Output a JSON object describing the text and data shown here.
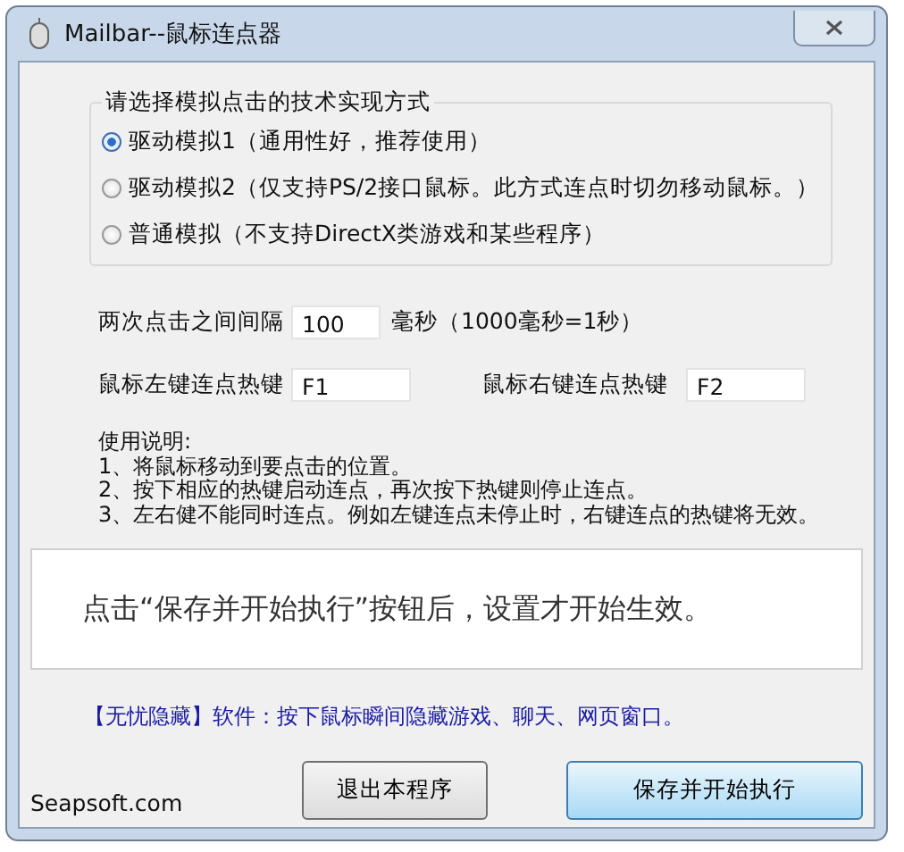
{
  "window": {
    "title": "Mailbar--鼠标连点器"
  },
  "mode_group": {
    "title": "请选择模拟点击的技术实现方式",
    "options": [
      {
        "label": "驱动模拟1（通用性好，推荐使用）",
        "selected": true
      },
      {
        "label": "驱动模拟2（仅支持PS/2接口鼠标。此方式连点时切勿移动鼠标。）",
        "selected": false
      },
      {
        "label": "普通模拟（不支持DirectX类游戏和某些程序）",
        "selected": false
      }
    ]
  },
  "interval": {
    "label": "两次点击之间间隔",
    "value": "100",
    "unit": "毫秒（1000毫秒=1秒）"
  },
  "hotkeys": [
    {
      "label": "鼠标左键连点热键",
      "value": "F1"
    },
    {
      "label": "鼠标右键连点热键",
      "value": "F2"
    }
  ],
  "instructions": [
    "使用说明:",
    "1、将鼠标移动到要点击的位置。",
    "2、按下相应的热键启动连点，再次按下热键则停止连点。",
    "3、左右健不能同时连点。例如左键连点未停止时，右键连点的热键将无效。"
  ],
  "notice": "点击“保存并开始执行”按钮后，设置才开始生效。",
  "promo_link": "【无忧隐藏】软件：按下鼠标瞬间隐藏游戏、聊天、网页窗口。",
  "footer": {
    "site": "Seapsoft.com",
    "buttons": [
      {
        "label": "退出本程序",
        "kind": "normal"
      },
      {
        "label": "保存并开始执行",
        "kind": "default"
      }
    ]
  }
}
